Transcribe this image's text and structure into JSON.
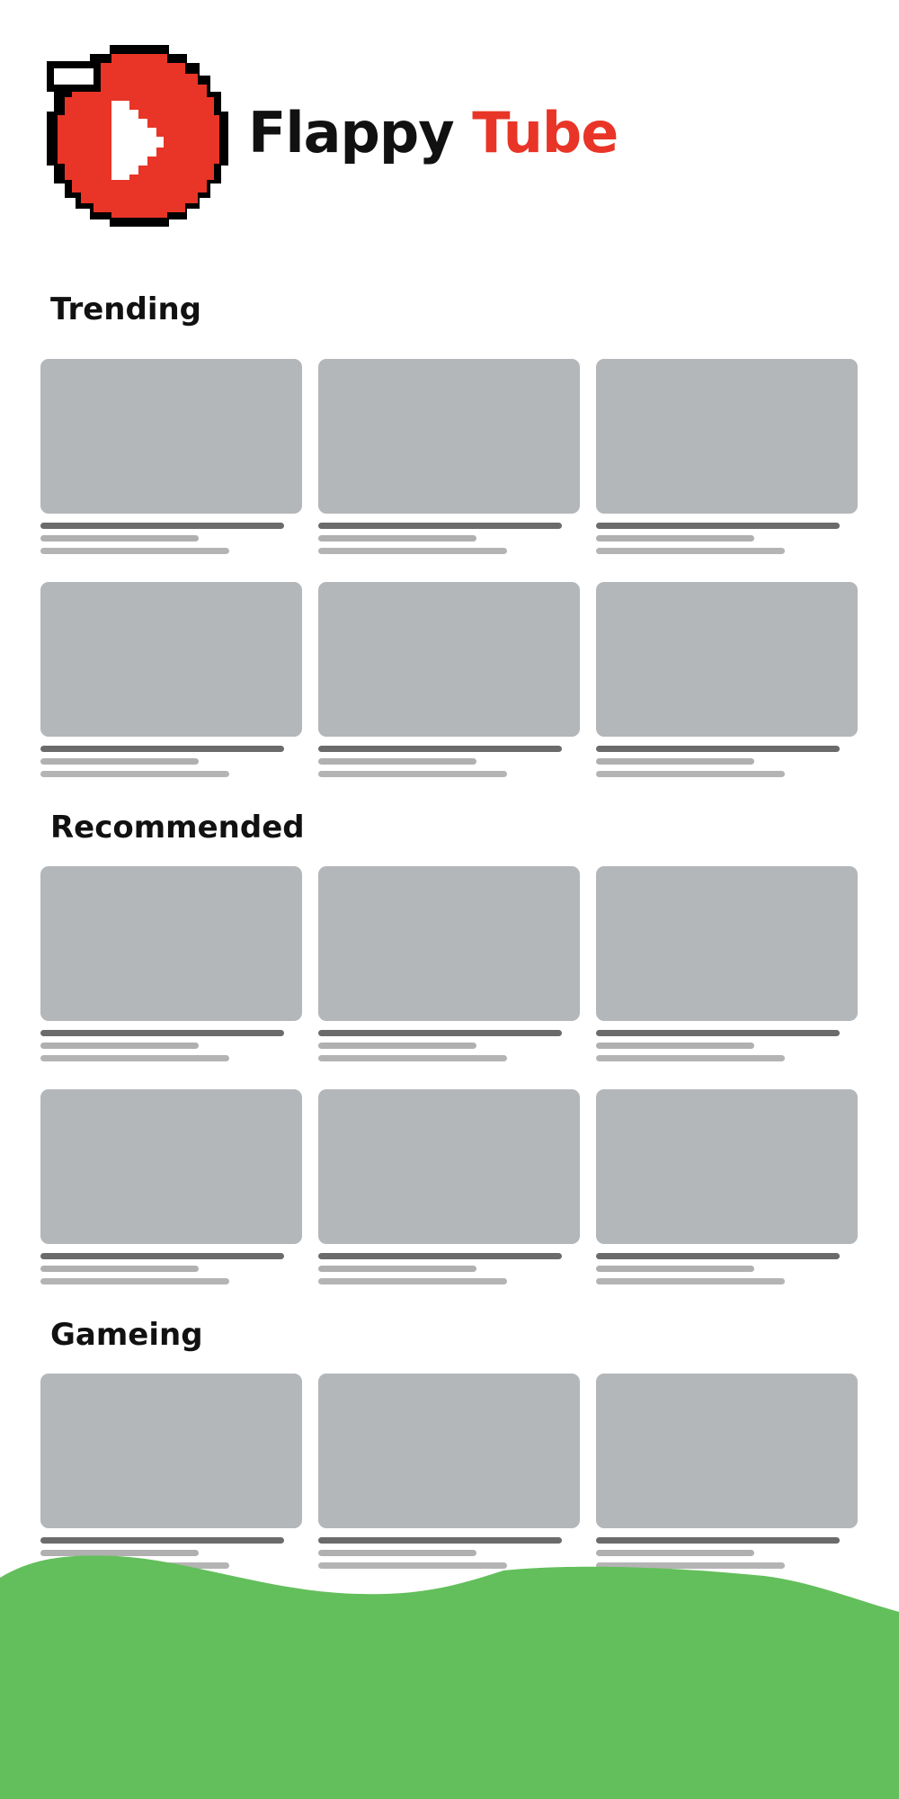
{
  "app": {
    "title_part1": "Flappy",
    "title_part2": "Tube",
    "logo_icon": "flappy-bird-play-icon"
  },
  "colors": {
    "accent": "#e83527",
    "title_text": "#111111",
    "background": "#ffffff",
    "thumbnail_placeholder": "#b4b7ba",
    "text_placeholder_dark": "#6b6b6b",
    "text_placeholder_light": "#b0b0b0",
    "ground": "#63bf5b"
  },
  "sections": [
    {
      "title": "Trending",
      "video_count": 6
    },
    {
      "title": "Recommended",
      "video_count": 6
    },
    {
      "title": "Gameing",
      "video_count": 3
    }
  ]
}
